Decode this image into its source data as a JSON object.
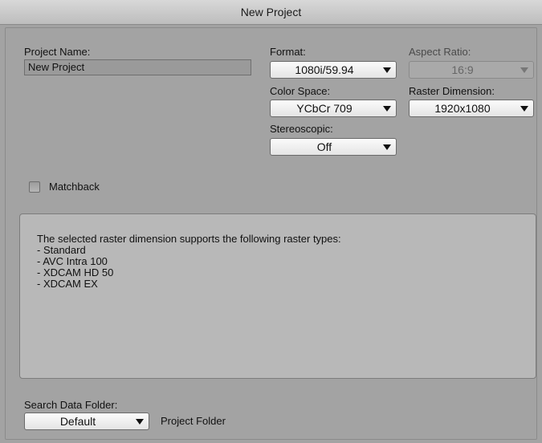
{
  "window": {
    "title": "New Project"
  },
  "project": {
    "name_label": "Project Name:",
    "name_value": "New Project"
  },
  "format": {
    "label": "Format:",
    "value": "1080i/59.94"
  },
  "aspect_ratio": {
    "label": "Aspect Ratio:",
    "value": "16:9",
    "enabled": false
  },
  "color_space": {
    "label": "Color Space:",
    "value": "YCbCr 709"
  },
  "raster_dimension": {
    "label": "Raster Dimension:",
    "value": "1920x1080"
  },
  "stereoscopic": {
    "label": "Stereoscopic:",
    "value": "Off"
  },
  "matchback": {
    "label": "Matchback",
    "checked": false
  },
  "info": {
    "heading": "The selected raster dimension supports the following raster types:",
    "items": [
      "- Standard",
      "- AVC Intra 100",
      "- XDCAM HD 50",
      "- XDCAM EX"
    ]
  },
  "search_data_folder": {
    "label": "Search Data Folder:",
    "value": "Default",
    "suffix": "Project Folder"
  }
}
